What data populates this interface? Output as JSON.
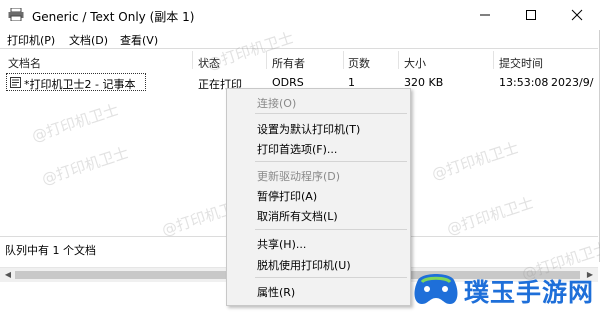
{
  "window": {
    "title": "Generic / Text Only (副本 1)"
  },
  "menu": {
    "printer": "打印机(P)",
    "document": "文档(D)",
    "view": "查看(V)"
  },
  "columns": [
    "文档名",
    "状态",
    "所有者",
    "页数",
    "大小",
    "提交时间"
  ],
  "rows": [
    {
      "name": "*打印机卫士2 - 记事本",
      "status": "正在打印",
      "owner": "ODRS",
      "pages": "1",
      "size": "320 KB",
      "time": "13:53:08",
      "date": "2023/9/"
    }
  ],
  "status_text": "队列中有 1 个文档",
  "context_menu": {
    "connect": "连接(O)",
    "set_default": "设置为默认打印机(T)",
    "preferences": "打印首选项(F)...",
    "update_driver": "更新驱动程序(D)",
    "pause": "暂停打印(A)",
    "cancel_all": "取消所有文档(L)",
    "share": "共享(H)...",
    "use_offline": "脱机使用打印机(U)",
    "properties": "属性(R)"
  },
  "watermark_text": "@打印机卫士",
  "brand": {
    "name": "璞玉手游网",
    "color": "#1e6fd9"
  },
  "icons": {
    "app": "printer-icon",
    "minimize": "minimize-icon",
    "maximize": "maximize-icon",
    "close": "close-icon",
    "document": "document-icon"
  }
}
